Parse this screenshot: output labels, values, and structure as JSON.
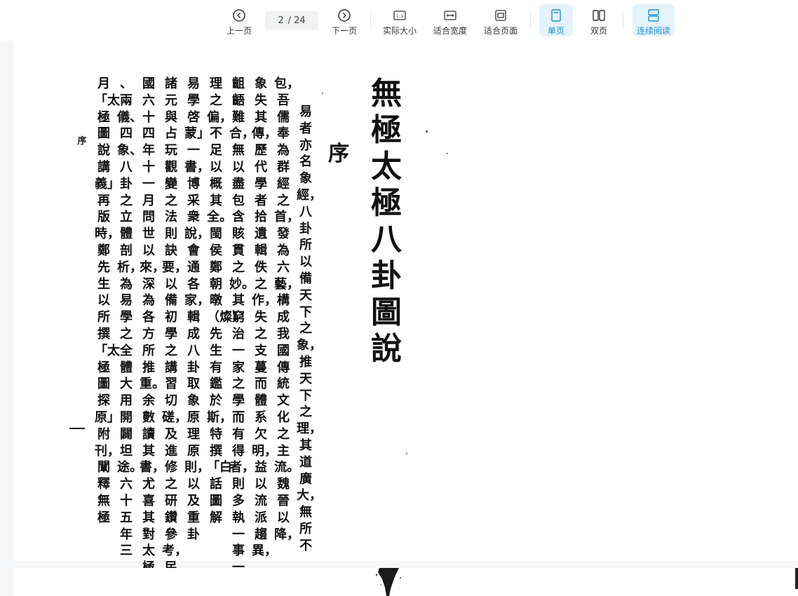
{
  "toolbar": {
    "prev_label": "上一页",
    "current_page": "2",
    "total_pages": "/ 24",
    "next_label": "下一页",
    "actual_size_label": "实际大小",
    "actual_size_icon_text": "1:1",
    "fit_width_label": "适合宽度",
    "fit_page_label": "适合页面",
    "single_page_label": "单页",
    "double_page_label": "双页",
    "continuous_label": "连续阅读",
    "accent_color": "#1a8fd6",
    "active_bg": "#e4f3fb"
  },
  "document": {
    "title": "無極太極八卦圖說",
    "heading": "序",
    "columns": [
      "易者亦名象經，八卦所以備天下之象，推天下之理，其道廣大，無所不",
      "包，吾儒奉為群經之首，發為六藝，構成我國傳統文化之主流。魏晉以降，",
      "象失其傳，歷代學者拾遺輯佚之作，失之支蔓而體系欠明，益以流派趨異，",
      "齟齬難合，無以盡包含賅貫之妙。其窮治一家之學而有得者，則多執一事一",
      "理之偏，不足以概其全。閩侯鄭朝暾（燦）先生有鑑於斯，特撰「白話圖解",
      "易學啓蒙」一書，博采衆說，會通各家，輯成八卦取象原理原則，以及重卦",
      "諸元與占玩觀變之法則訣要，以備初學之講習切磋，及進修之研鑽參考，民",
      "國六十四年十一月問世以來，深為各方所推重。余數讀其書，尤喜其對太極",
      "、兩儀、四象、八卦之立體剖析，為易學之全體大用開闢坦途。六十五年三",
      "月「太極圖說講義」再版時，鄭先生以所撰「太極圖探原」附刊，闡釋無極"
    ],
    "side_label": "序"
  }
}
